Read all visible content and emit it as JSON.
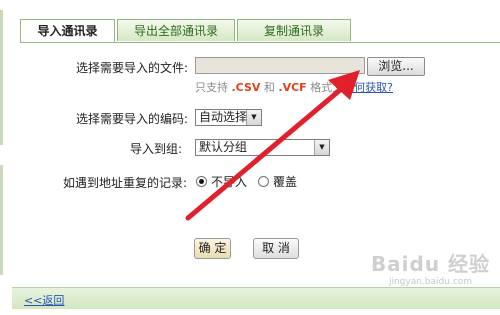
{
  "tabs": [
    {
      "label": "导入通讯录",
      "active": true
    },
    {
      "label": "导出全部通讯录",
      "active": false
    },
    {
      "label": "复制通讯录",
      "active": false
    }
  ],
  "form": {
    "file_label": "选择需要导入的文件:",
    "browse_button": "浏览...",
    "file_value": "",
    "hint_prefix": "只支持",
    "hint_csv": ".CSV",
    "hint_and": "和",
    "hint_vcf": ".VCF",
    "hint_suffix": "格式文",
    "how_to_get": "如何获取?",
    "encoding_label": "选择需要导入的编码:",
    "encoding_value": "自动选择",
    "group_label": "导入到组:",
    "group_value": "默认分组",
    "duplicate_label": "如遇到地址重复的记录:",
    "radio_skip": "不导入",
    "radio_overwrite": "覆盖",
    "radio_selected": "不导入"
  },
  "buttons": {
    "ok": "确 定",
    "cancel": "取 消"
  },
  "footer": {
    "back": "<<返回"
  },
  "watermark": {
    "main": "Baidu 经验",
    "url": "jingyan.baidu.com"
  },
  "colors": {
    "arrow": "#e0202a",
    "tab_border": "#8fba7c",
    "footer_bg": "#d9ebc8",
    "link": "#2a55b6"
  }
}
